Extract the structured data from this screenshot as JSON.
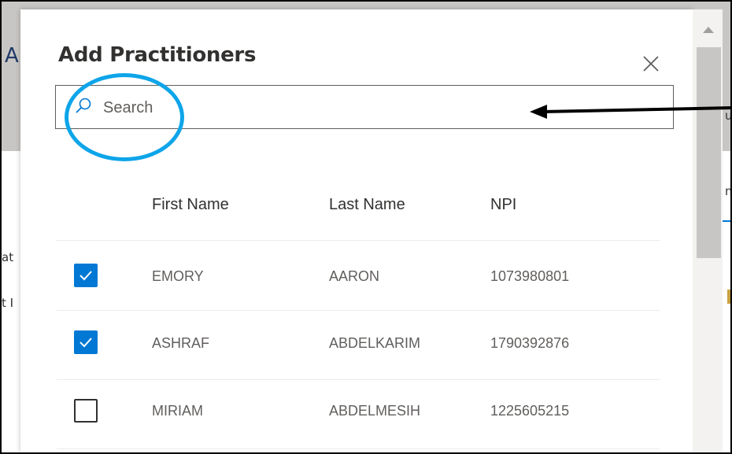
{
  "background": {
    "fragments": [
      "A",
      "at",
      "t I",
      "u",
      "n"
    ]
  },
  "modal": {
    "title": "Add Practitioners",
    "search": {
      "placeholder": "Search",
      "value": ""
    },
    "table": {
      "columns": [
        "First Name",
        "Last Name",
        "NPI"
      ],
      "rows": [
        {
          "selected": true,
          "first_name": "EMORY",
          "last_name": "AARON",
          "npi": "1073980801"
        },
        {
          "selected": true,
          "first_name": "ASHRAF",
          "last_name": "ABDELKARIM",
          "npi": "1790392876"
        },
        {
          "selected": false,
          "first_name": "MIRIAM",
          "last_name": "ABDELMESIH",
          "npi": "1225605215"
        }
      ]
    }
  },
  "icons": {
    "close": "close-icon",
    "search": "search-icon",
    "checkmark": "checkmark-icon",
    "scroll_up": "chevron-up-icon"
  },
  "colors": {
    "accent": "#0078d4",
    "annotation": "#0ea5e9",
    "text": "#323130",
    "muted_text": "#605e5c"
  }
}
